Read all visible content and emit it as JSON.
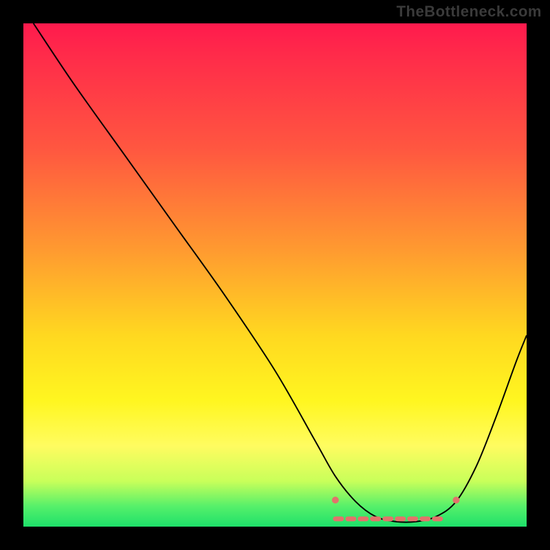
{
  "watermark": "TheBottleneck.com",
  "chart_data": {
    "type": "line",
    "title": "",
    "xlabel": "",
    "ylabel": "",
    "xlim": [
      0,
      100
    ],
    "ylim": [
      0,
      100
    ],
    "grid": false,
    "legend": false,
    "series": [
      {
        "name": "curve",
        "x": [
          2,
          10,
          20,
          30,
          40,
          50,
          58,
          62,
          66,
          70,
          74,
          78,
          82,
          86,
          90,
          94,
          98,
          100
        ],
        "values": [
          100,
          88,
          74,
          60,
          46,
          31,
          17,
          10,
          5,
          2,
          1,
          1,
          2,
          5,
          12,
          22,
          33,
          38
        ]
      }
    ],
    "annotations": {
      "trough_start_x": 62,
      "trough_end_x": 84,
      "trough_value": 1,
      "edge_dots": [
        {
          "x": 62,
          "y": 5
        },
        {
          "x": 86,
          "y": 5
        }
      ]
    },
    "gradient_colors": {
      "top": "#ff1a4d",
      "mid_upper": "#ff9a30",
      "mid_lower": "#fff620",
      "bottom": "#1ee06a",
      "border": "#000000",
      "trough_dash": "#e2736b"
    }
  }
}
